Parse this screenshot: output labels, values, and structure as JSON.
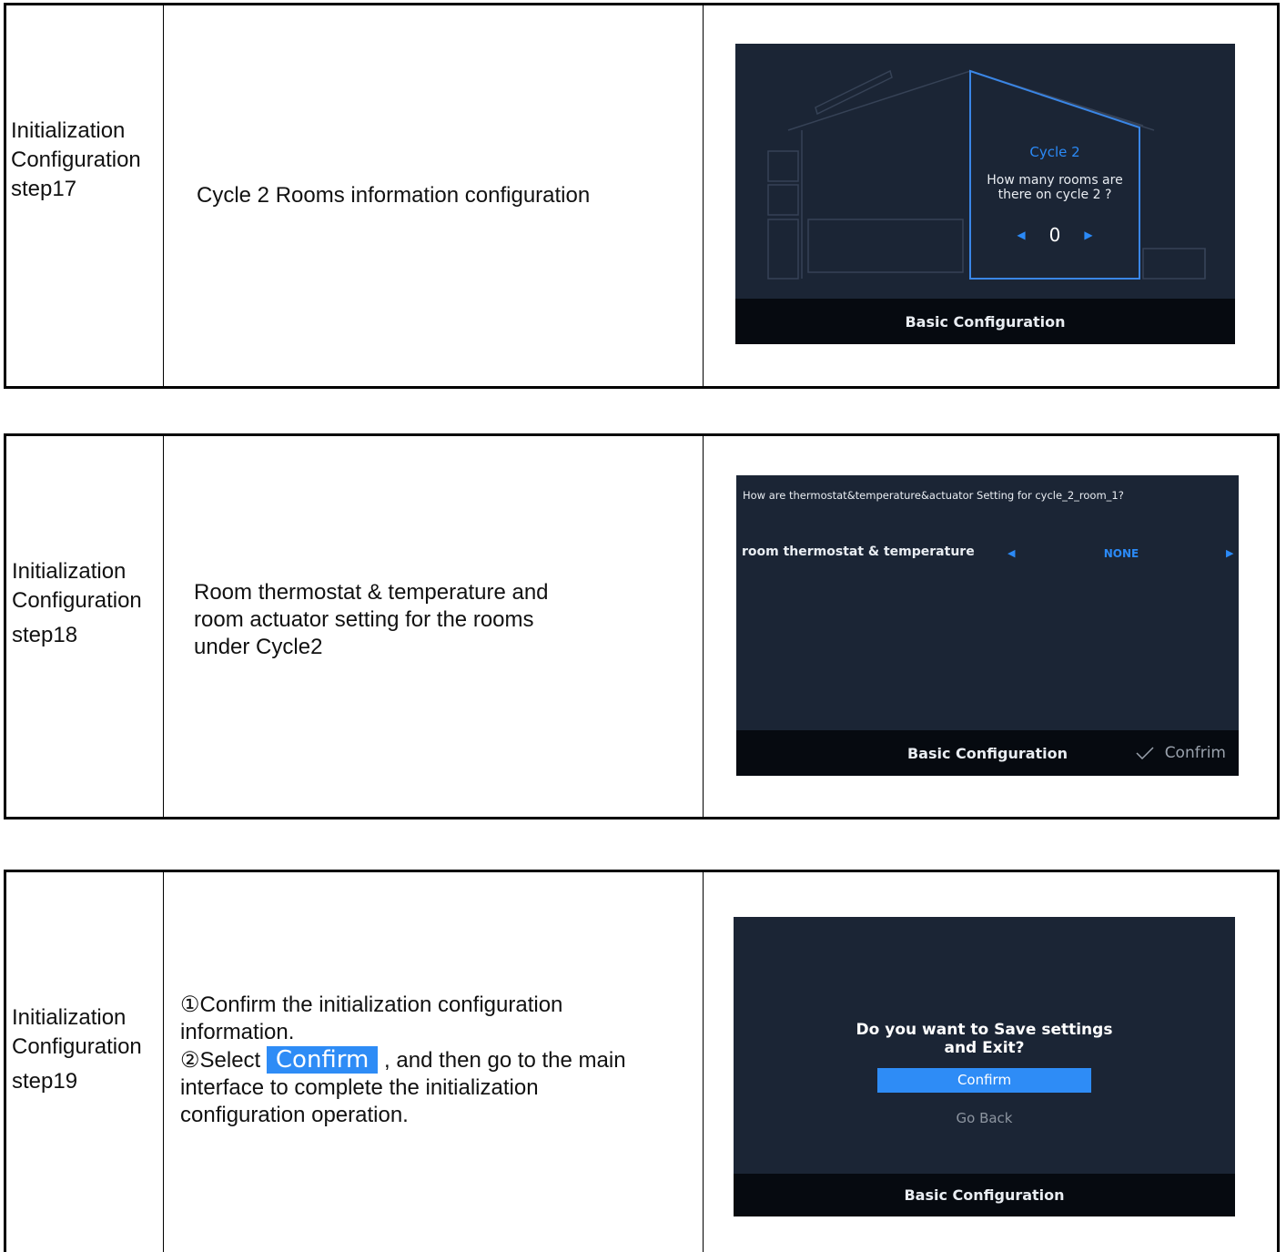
{
  "rows": [
    {
      "step_lines": [
        "Initialization",
        "Configuration",
        "step17"
      ],
      "description": "Cycle 2 Rooms information configuration",
      "screen": {
        "cycle_title": "Cycle 2",
        "question_line1": "How many rooms are",
        "question_line2": "there on cycle 2 ?",
        "value": "0",
        "bottom_label": "Basic Configuration"
      }
    },
    {
      "step_lines": [
        "Initialization",
        "Configuration",
        "step18"
      ],
      "description_lines": [
        "Room thermostat & temperature and",
        "room actuator setting for the rooms",
        "under Cycle2"
      ],
      "screen": {
        "question": "How are  thermostat&temperature&actuator Setting for cycle_2_room_1?",
        "setting_label": "room thermostat & temperature",
        "setting_value": "NONE",
        "bottom_label": "Basic Configuration",
        "confirm_label": "Confrim"
      }
    },
    {
      "step_lines": [
        "Initialization",
        "Configuration",
        "step19"
      ],
      "description": {
        "line1": "①Confirm the initialization configuration",
        "line2": "information.",
        "line3_prefix": "②Select ",
        "line3_button": "Confirm",
        "line3_suffix": " , and then go to the main",
        "line4": "interface to complete the initialization",
        "line5": "configuration operation."
      },
      "screen": {
        "question_line1": "Do you want to Save settings",
        "question_line2": "and Exit?",
        "confirm_label": "Confirm",
        "goback_label": "Go Back",
        "bottom_label": "Basic Configuration"
      }
    }
  ],
  "colors": {
    "screen_bg": "#1b2535",
    "bottom_bar": "#060a10",
    "accent_blue": "#2b8af7"
  },
  "icons": [
    "chevron-left-icon",
    "chevron-right-icon",
    "checkmark-icon"
  ]
}
